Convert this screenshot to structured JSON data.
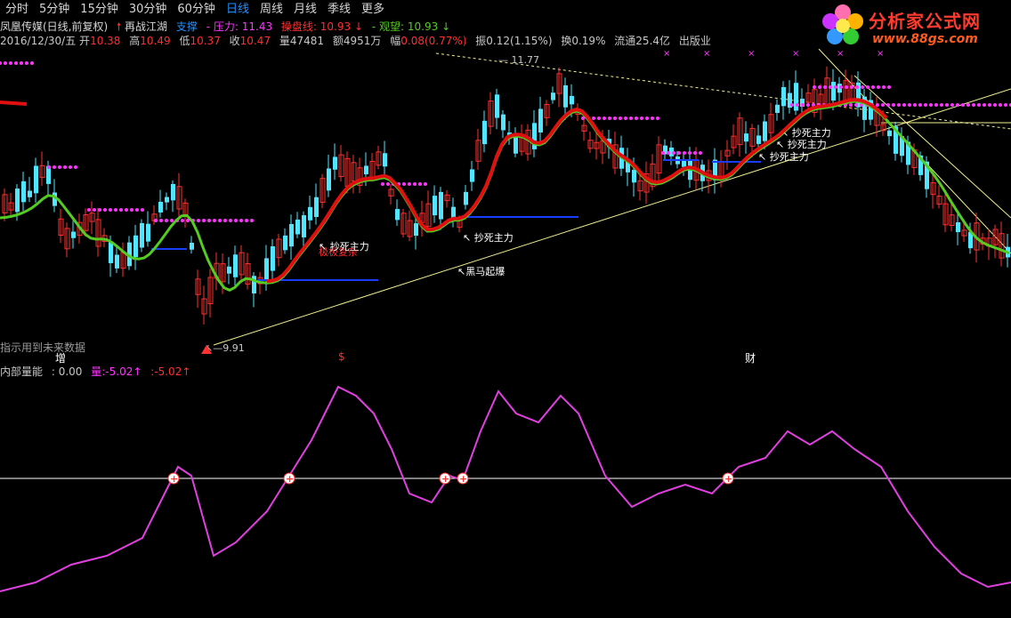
{
  "toolbar": {
    "tabs": [
      {
        "label": "分时",
        "active": false
      },
      {
        "label": "5分钟",
        "active": false
      },
      {
        "label": "15分钟",
        "active": false
      },
      {
        "label": "30分钟",
        "active": false
      },
      {
        "label": "60分钟",
        "active": false
      },
      {
        "label": "日线",
        "active": true
      },
      {
        "label": "周线",
        "active": false
      },
      {
        "label": "月线",
        "active": false
      },
      {
        "label": "季线",
        "active": false
      },
      {
        "label": "更多",
        "active": false
      }
    ]
  },
  "logo": {
    "name": "分析家公式网",
    "url": "www.88gs.com"
  },
  "stock": {
    "name": "凤凰传媒(日线,前复权)",
    "indicator": "再战江湖",
    "support_label": "支撑",
    "pressure_label": "压力:",
    "pressure_value": "11.43",
    "trade_label": "操盘线:",
    "trade_value": "10.93",
    "watch_label": "观望:",
    "watch_value": "10.93"
  },
  "quote": {
    "date": "2016/12/30/五",
    "open_label": "开",
    "open": "10.38",
    "high_label": "高",
    "high": "10.49",
    "low_label": "低",
    "low": "10.37",
    "close_label": "收",
    "close": "10.47",
    "volume": "量47481",
    "amount": "额4951万",
    "change_label": "幅",
    "change": "0.08(0.77%)",
    "amplitude": "振0.12(1.15%)",
    "turnover": "换0.19%",
    "float": "流通25.4亿",
    "industry": "出版业"
  },
  "annotations": {
    "high_price": "11.77",
    "low_price": "9.91",
    "buy_signals": [
      "抄死主力",
      "抄死主力",
      "抄死主力",
      "抄死主力",
      "抄死主力"
    ],
    "breakout": "黑马起爆",
    "faded": "极极复杂"
  },
  "note": "指示用到未来数据",
  "markers": [
    {
      "label": "增",
      "color": "#ffffff"
    },
    {
      "label": "$",
      "color": "#ff3030"
    },
    {
      "label": "财",
      "color": "#ffffff"
    }
  ],
  "sub": {
    "name": "内部量能",
    "value": ": 0.00",
    "v1": "量:-5.02↑",
    "v2": ":-5.02↑"
  },
  "colors": {
    "up": "#ff3030",
    "down": "#50e6ff",
    "ma_green": "#55cc22",
    "ma_red": "#e01010",
    "dots": "#ff33ff",
    "support": "#1a3cff",
    "energy": "#e040e0",
    "accent": "#1e90ff"
  }
}
